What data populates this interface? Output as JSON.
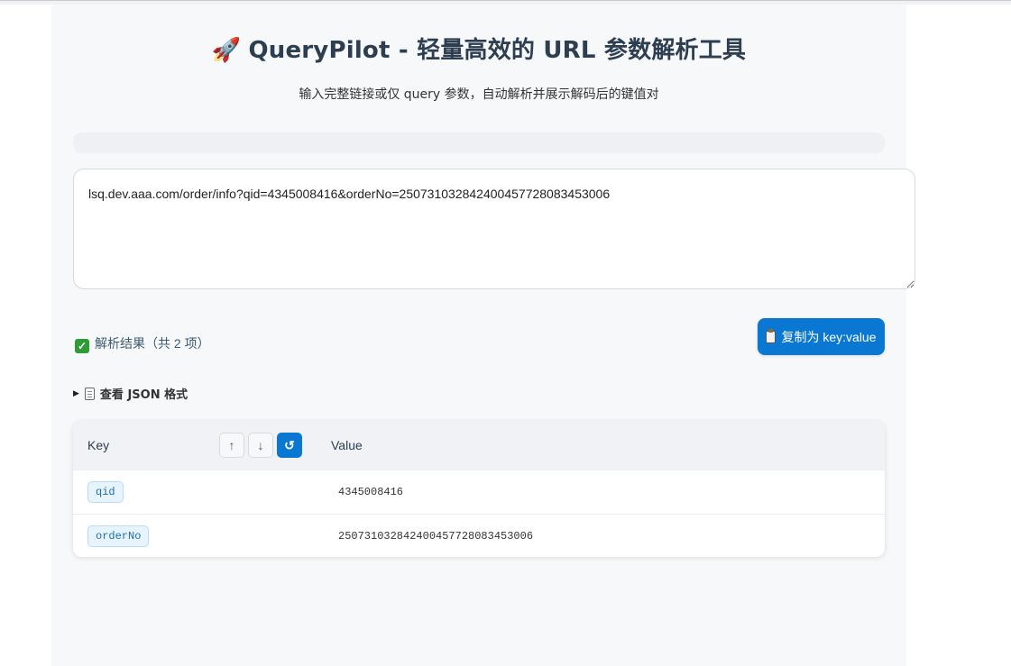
{
  "header": {
    "title": "QueryPilot - 轻量高效的 URL 参数解析工具",
    "subtitle": "输入完整链接或仅 query 参数，自动解析并展示解码后的键值对"
  },
  "input": {
    "value": "lsq.dev.aaa.com/order/info?qid=4345008416&orderNo=250731032842400457728083453006"
  },
  "result": {
    "label": "解析结果（共 2 项）",
    "copy_button": "复制为 key:value",
    "json_toggle": "查看 JSON 格式"
  },
  "table": {
    "headers": {
      "key": "Key",
      "value": "Value"
    },
    "sort_buttons": [
      "↑",
      "↓",
      "↺"
    ],
    "rows": [
      {
        "key": "qid",
        "value": "4345008416"
      },
      {
        "key": "orderNo",
        "value": "250731032842400457728083453006"
      }
    ]
  },
  "colors": {
    "accent": "#0a78d2",
    "background": "#f7f8fa",
    "check": "#2e9b36"
  }
}
